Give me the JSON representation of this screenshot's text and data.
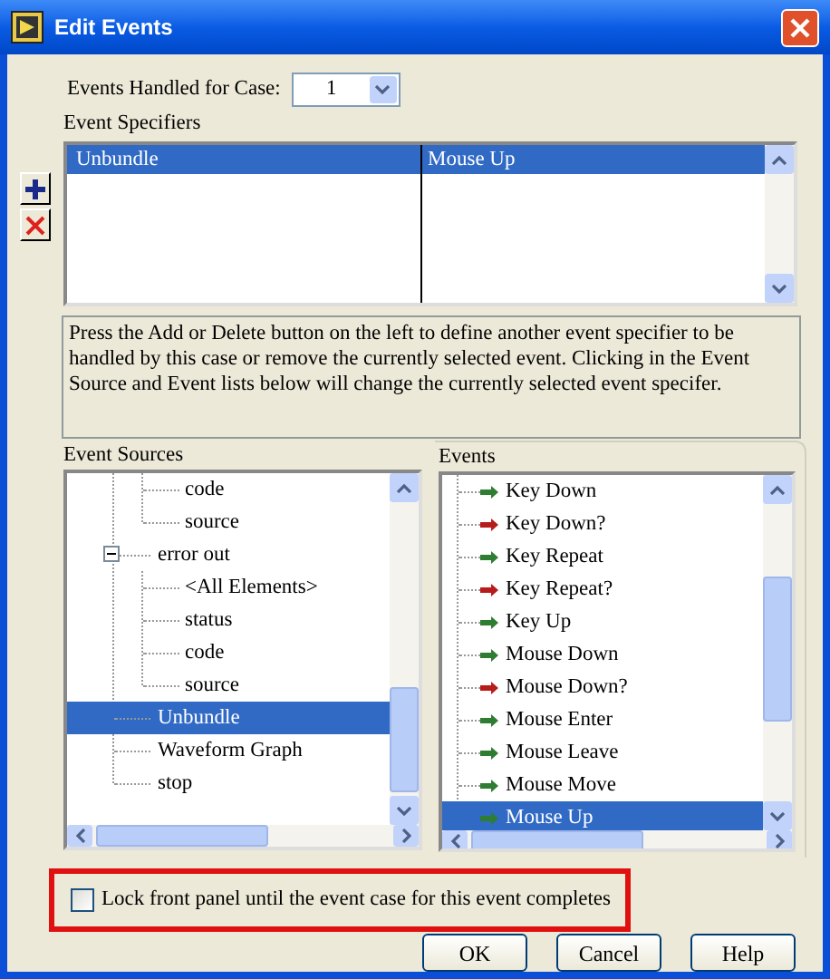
{
  "window": {
    "title": "Edit Events"
  },
  "case_selector": {
    "label": "Events Handled for Case:",
    "value": "1"
  },
  "specifiers": {
    "label": "Event Specifiers",
    "rows": [
      {
        "source": "Unbundle",
        "event": "Mouse Up",
        "selected": true
      }
    ]
  },
  "description": "Press the Add or Delete button on the left to define another event specifier to be handled by this case or remove the currently selected event. Clicking in the Event Source and Event lists below will change the currently selected event specifer.",
  "event_sources": {
    "label": "Event Sources",
    "items": [
      {
        "kind": "continuation",
        "children": [
          {
            "label": "code",
            "selected": false
          },
          {
            "label": "source",
            "selected": false
          }
        ]
      },
      {
        "kind": "node",
        "label": "error out",
        "expanded": true,
        "selected": false,
        "children": [
          {
            "label": "<All Elements>",
            "selected": false
          },
          {
            "label": "status",
            "selected": false
          },
          {
            "label": "code",
            "selected": false
          },
          {
            "label": "source",
            "selected": false
          }
        ]
      },
      {
        "kind": "node",
        "label": "Unbundle",
        "selected": true
      },
      {
        "kind": "node",
        "label": "Waveform Graph",
        "selected": false
      },
      {
        "kind": "node",
        "label": "stop",
        "selected": false
      }
    ]
  },
  "events": {
    "label": "Events",
    "items": [
      {
        "label": "Key Down",
        "color": "#2e7d32",
        "selected": false
      },
      {
        "label": "Key Down?",
        "color": "#b71c1c",
        "selected": false
      },
      {
        "label": "Key Repeat",
        "color": "#2e7d32",
        "selected": false
      },
      {
        "label": "Key Repeat?",
        "color": "#b71c1c",
        "selected": false
      },
      {
        "label": "Key Up",
        "color": "#2e7d32",
        "selected": false
      },
      {
        "label": "Mouse Down",
        "color": "#2e7d32",
        "selected": false
      },
      {
        "label": "Mouse Down?",
        "color": "#b71c1c",
        "selected": false
      },
      {
        "label": "Mouse Enter",
        "color": "#2e7d32",
        "selected": false
      },
      {
        "label": "Mouse Leave",
        "color": "#2e7d32",
        "selected": false
      },
      {
        "label": "Mouse Move",
        "color": "#2e7d32",
        "selected": false
      },
      {
        "label": "Mouse Up",
        "color": "#2e7d32",
        "selected": true
      }
    ]
  },
  "lock_option": {
    "label": "Lock front panel until the event case for this event completes",
    "checked": false,
    "highlighted": true
  },
  "buttons": [
    "OK",
    "Cancel",
    "Help"
  ]
}
